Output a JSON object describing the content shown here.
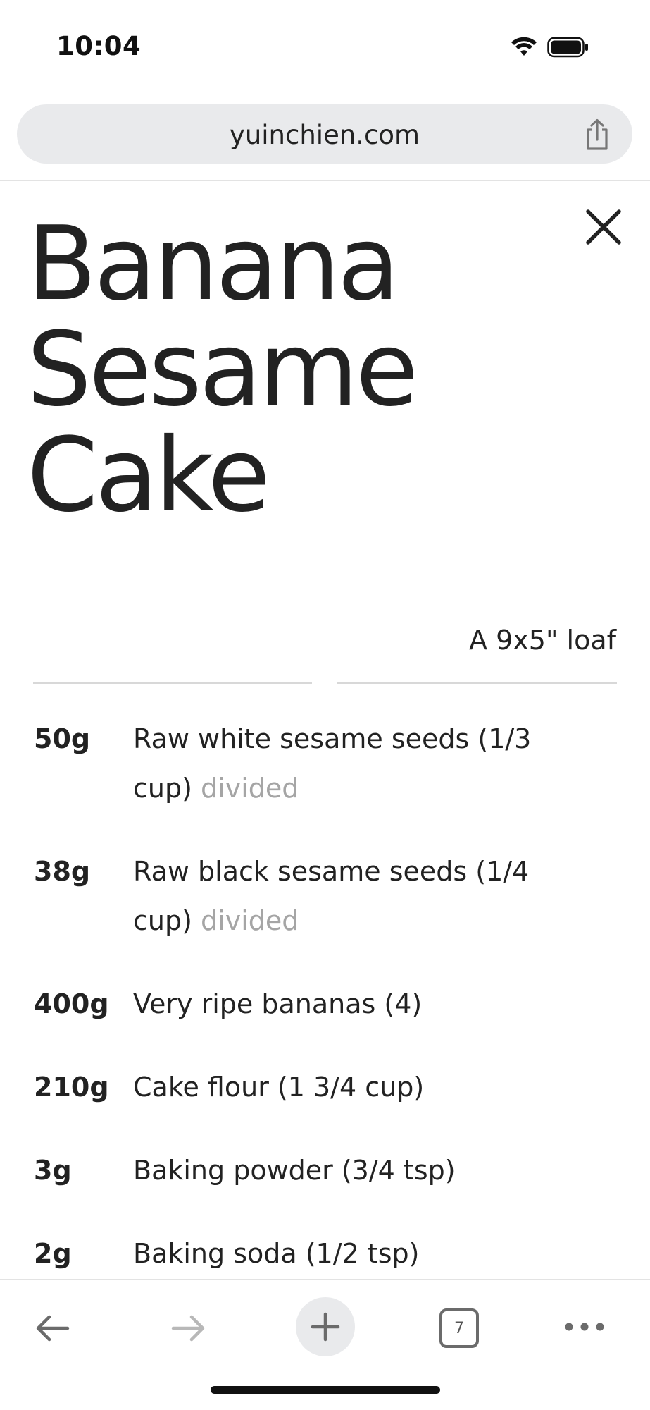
{
  "status_bar": {
    "time": "10:04",
    "icons": [
      "wifi-icon",
      "battery-icon"
    ]
  },
  "browser": {
    "url": "yuinchien.com",
    "tab_count": "7",
    "toolbar_icons": [
      "back-arrow-icon",
      "forward-arrow-icon",
      "plus-icon",
      "tabs-icon",
      "more-icon"
    ]
  },
  "recipe": {
    "title_lines": [
      "Banana",
      "Sesame",
      "Cake"
    ],
    "yield": "A 9x5\" loaf",
    "ingredients": [
      {
        "qty": "50g",
        "name": "Raw white sesame seeds (1/3",
        "name2": "cup)",
        "note": "divided"
      },
      {
        "qty": "38g",
        "name": "Raw black sesame seeds (1/4",
        "name2": "cup)",
        "note": "divided"
      },
      {
        "qty": "400g",
        "name": "Very ripe bananas (4)"
      },
      {
        "qty": "210g",
        "name": "Cake flour (1 3/4 cup)"
      },
      {
        "qty": "3g",
        "name": "Baking powder (3/4 tsp)"
      },
      {
        "qty": "2g",
        "name": "Baking soda (1/2 tsp)"
      }
    ]
  },
  "colors": {
    "url_bar_bg": "#e9eaec",
    "text": "#222222",
    "note_text": "#a5a5a5"
  }
}
